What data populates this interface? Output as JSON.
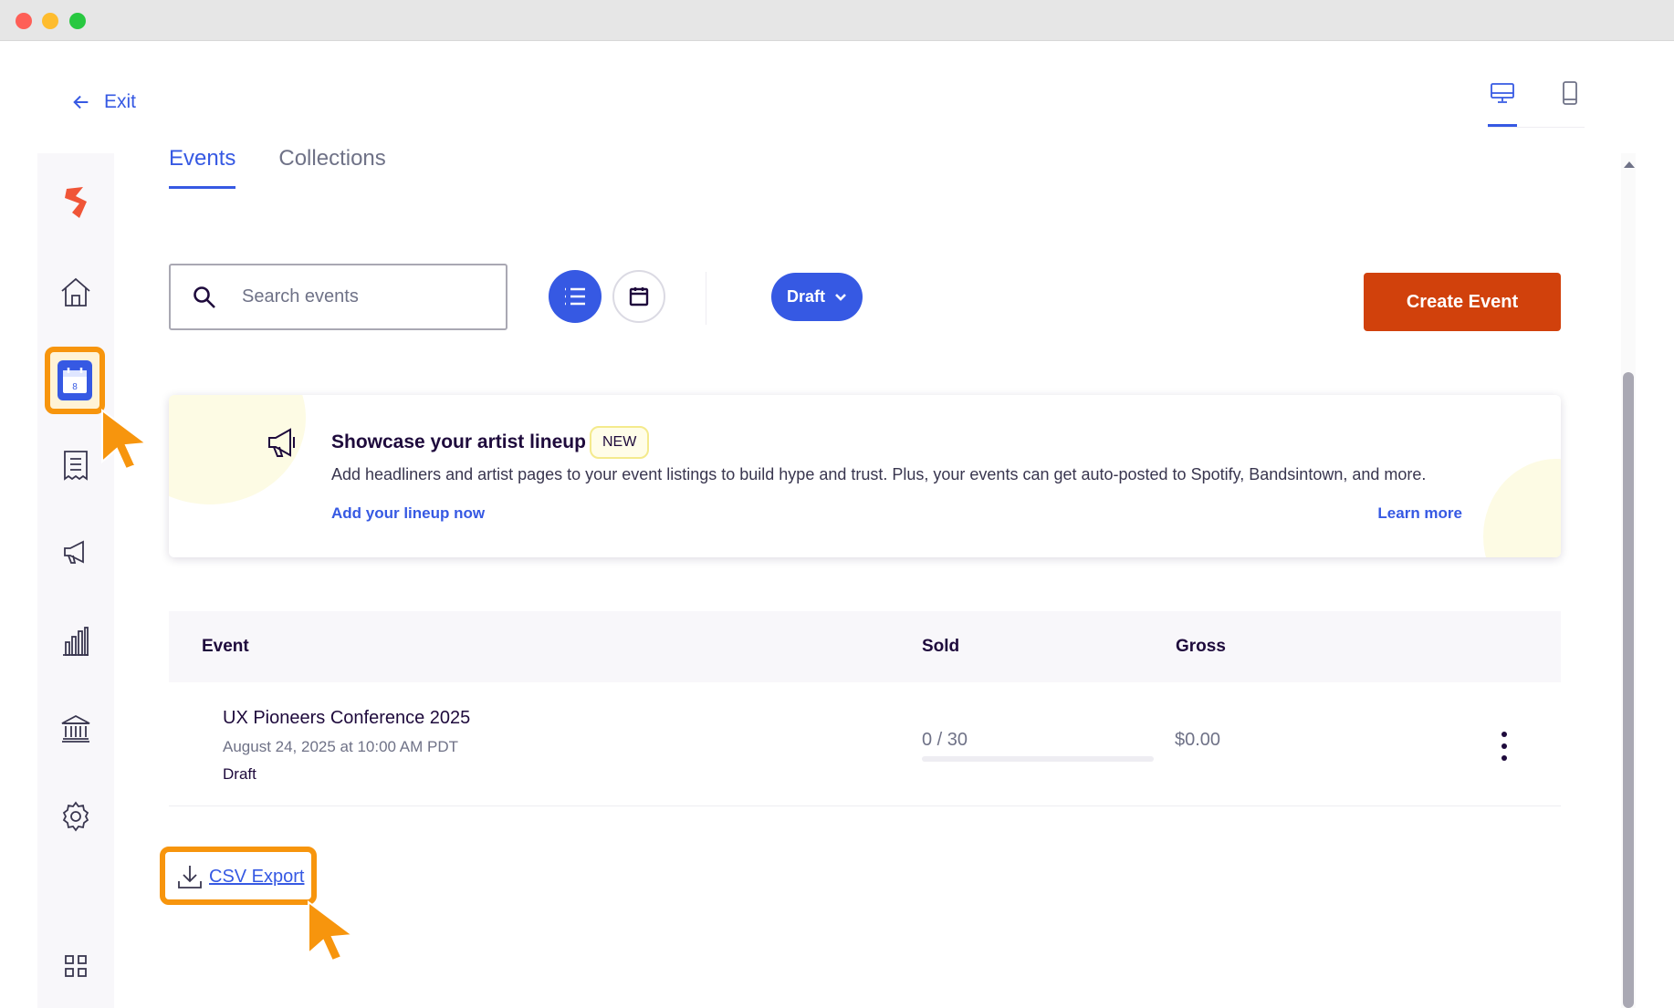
{
  "window": {
    "controls": [
      "close",
      "minimize",
      "zoom"
    ]
  },
  "header": {
    "exit_label": "Exit",
    "view_toggle": {
      "selected": "desktop",
      "options": [
        "desktop-icon",
        "mobile-icon"
      ]
    }
  },
  "sidebar": {
    "items": [
      {
        "name": "brand-logo-icon"
      },
      {
        "name": "home-icon"
      },
      {
        "name": "calendar-icon",
        "active": true,
        "badge": "8"
      },
      {
        "name": "orders-icon"
      },
      {
        "name": "megaphone-icon"
      },
      {
        "name": "reports-icon"
      },
      {
        "name": "finance-icon"
      },
      {
        "name": "gear-icon"
      },
      {
        "name": "apps-grid-icon"
      }
    ]
  },
  "tabs": [
    {
      "label": "Events",
      "active": true
    },
    {
      "label": "Collections",
      "active": false
    }
  ],
  "search": {
    "placeholder": "Search events",
    "value": ""
  },
  "filters": {
    "status_label": "Draft"
  },
  "create_event_label": "Create Event",
  "banner": {
    "title": "Showcase your artist lineup",
    "badge": "NEW",
    "description": "Add headliners and artist pages to your event listings to build hype and trust. Plus, your events can get auto-posted to Spotify, Bandsintown, and more.",
    "cta_primary": "Add your lineup now",
    "cta_secondary": "Learn more"
  },
  "table": {
    "headers": {
      "event": "Event",
      "sold": "Sold",
      "gross": "Gross"
    },
    "rows": [
      {
        "name": "UX Pioneers Conference 2025",
        "date": "August 24, 2025 at 10:00 AM PDT",
        "status": "Draft",
        "sold": "0 / 30",
        "sold_fraction": 0,
        "gross": "$0.00"
      }
    ]
  },
  "csv_export_label": "CSV Export",
  "colors": {
    "primary": "#3659e3",
    "cta": "#d1410c",
    "highlight": "#f7950d",
    "text": "#1e0a3c"
  }
}
